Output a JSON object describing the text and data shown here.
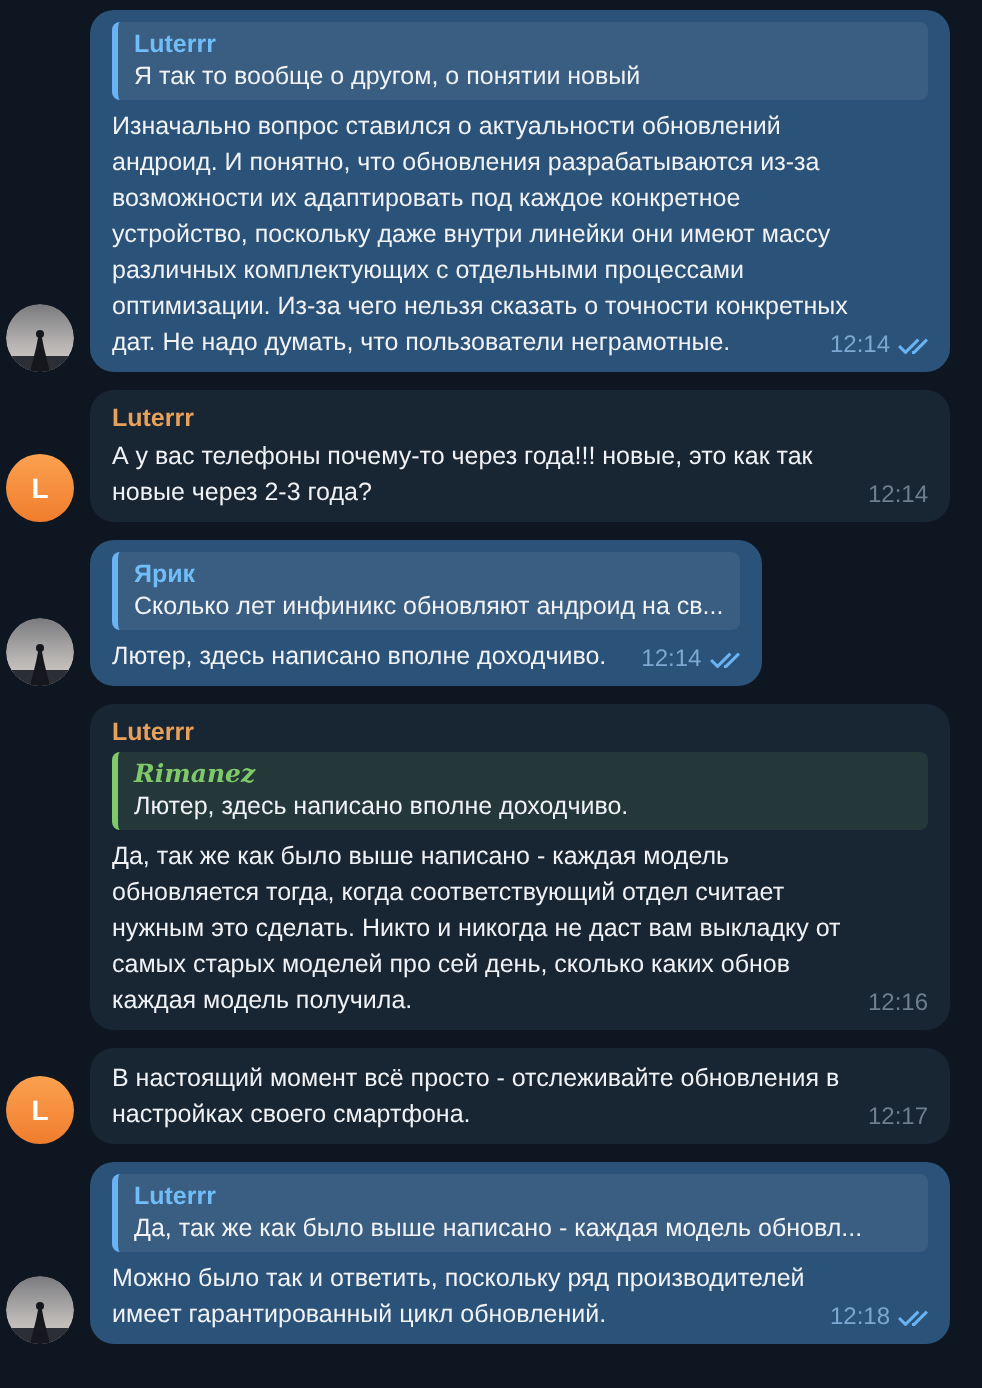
{
  "messages": [
    {
      "kind": "outgoing",
      "reply": {
        "author": "Luterrr",
        "text": "Я так то вообще о другом, о понятии новый",
        "color": "#6ab3f3"
      },
      "text": "Изначально вопрос ставился о актуальности обновлений\nандроид. И понятно, что обновления разрабатываются из-за\nвозможности их адаптировать под каждое конкретное\nустройство, поскольку даже внутри линейки они имеют массу\nразличных комплектующих с отдельными процессами\nоптимизации. Из-за чего нельзя сказать о точности конкретных\nдат. Не надо думать, что пользователи неграмотные.",
      "time": "12:14",
      "read": true
    },
    {
      "kind": "incoming",
      "avatar": {
        "kind": "letter",
        "letter": "L"
      },
      "sender": "Luterrr",
      "text": "А у вас телефоны почему-то через года!!! новые, это как так\nновые через 2-3 года?",
      "time": "12:14"
    },
    {
      "kind": "outgoing",
      "reply": {
        "author": "Ярик",
        "text": "Сколько лет инфиникс обновляют андроид на св...",
        "color": "#6ab3f3"
      },
      "text": "Лютер, здесь написано вполне доходчиво.",
      "time": "12:14",
      "read": true
    },
    {
      "kind": "incoming",
      "avatar": {
        "kind": "none"
      },
      "sender": "Luterrr",
      "reply": {
        "author": "Rimanez",
        "text": "Лютер, здесь написано вполне доходчиво.",
        "color": "#7fc96a"
      },
      "text": "Да, так же как было выше написано - каждая модель\nобновляется тогда, когда соответствующий отдел считает\nнужным это сделать. Никто и никогда не даст вам выкладку от\nсамых старых моделей про сей день, сколько каких обнов\nкаждая модель получила.",
      "time": "12:16"
    },
    {
      "kind": "incoming",
      "avatar": {
        "kind": "letter",
        "letter": "L"
      },
      "text": "В настоящий момент всё просто - отслеживайте обновления в\nнастройках своего смартфона.",
      "time": "12:17"
    },
    {
      "kind": "outgoing",
      "reply": {
        "author": "Luterrr",
        "text": "Да, так же как было выше написано - каждая модель обновл...",
        "color": "#6ab3f3"
      },
      "text": "Можно было так и ответить, поскольку ряд производителей\nимеет гарантированный цикл обновлений.",
      "time": "12:18",
      "read": true
    }
  ]
}
